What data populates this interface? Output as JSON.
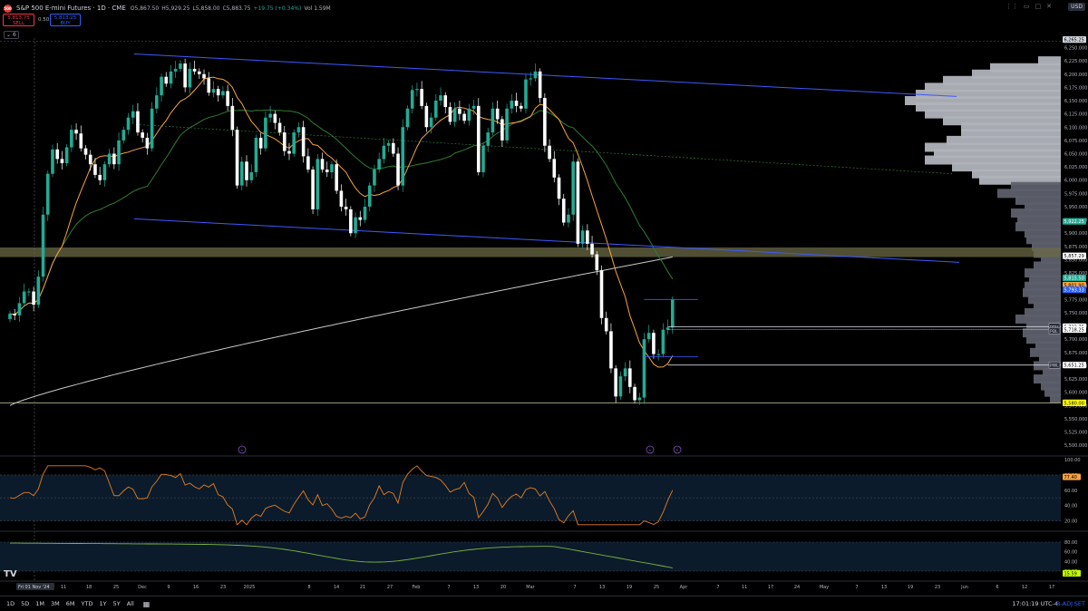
{
  "header": {
    "title": "S&P 500 E-mini Futures · 1D · CME",
    "logo_text": "500",
    "ohlc": {
      "o": "O5,867.50",
      "h": "H5,929.25",
      "l": "L5,858.00",
      "c": "C5,883.75",
      "chg": "+19.75 (+0.34%)",
      "vol": "Vol 1.59M"
    },
    "sell_price": "5,813.75",
    "sell_label": "SELL",
    "buy_price": "5,813.25",
    "buy_label": "BUY",
    "spread": "0.50",
    "collapse_label": "6",
    "currency": "USD",
    "icons": [
      "drag-icon",
      "minimize-icon",
      "maximize-icon",
      "close-icon"
    ]
  },
  "bottom": {
    "timeframes": [
      "1D",
      "5D",
      "1M",
      "3M",
      "6M",
      "YTD",
      "1Y",
      "5Y",
      "All"
    ],
    "clock": "17:01:19 UTC-4",
    "badj": "B-ADJ",
    "set": "SET"
  },
  "colors": {
    "bull": "#22ab94",
    "bear": "#ffffff",
    "ma_fast": "#f7a440",
    "ma_mid": "#2e7d32",
    "ma_slow": "#c8c8c8",
    "channel": "#3d5afe",
    "rsi": "#e67e22",
    "adx": "#7cb342",
    "profile_light": "#b0b3bb",
    "profile_dark": "#5d606b",
    "zone": "#6b6a45"
  },
  "chart_data": [
    {
      "type": "candlestick",
      "title": "S&P 500 E-mini Futures · 1D · CME",
      "yticks": [
        5500,
        5525,
        5550,
        5575,
        5600,
        5625,
        5650,
        5675,
        5700,
        5725,
        5750,
        5775,
        5800,
        5825,
        5850,
        5875,
        5900,
        5925,
        5950,
        5975,
        6000,
        6025,
        6050,
        6075,
        6100,
        6125,
        6150,
        6175,
        6200,
        6225,
        6250
      ],
      "ylim": [
        5490,
        6268
      ],
      "xlabels": [
        "Fri 01 Nov '24",
        "11",
        "18",
        "25",
        "Dec",
        "9",
        "16",
        "23",
        "2025",
        "8",
        "14",
        "21",
        "27",
        "Feb",
        "7",
        "13",
        "20",
        "Mar",
        "7",
        "13",
        "19",
        "25",
        "Apr",
        "7",
        "11",
        "17",
        "24",
        "May",
        "7",
        "13",
        "19",
        "23",
        "Jun",
        "6",
        "12",
        "17"
      ],
      "closes": [
        5748,
        5745,
        5768,
        5790,
        5790,
        5765,
        5818,
        5935,
        6012,
        6058,
        6040,
        6032,
        6062,
        6095,
        6088,
        6060,
        6048,
        6030,
        6010,
        6000,
        6030,
        6050,
        6030,
        6075,
        6095,
        6118,
        6130,
        6090,
        6080,
        6060,
        6135,
        6160,
        6195,
        6182,
        6205,
        6210,
        6220,
        6175,
        6210,
        6205,
        6200,
        6192,
        6165,
        6172,
        6160,
        6168,
        6140,
        6095,
        5990,
        6035,
        6000,
        6015,
        6080,
        6060,
        6118,
        6125,
        6108,
        6090,
        6055,
        6050,
        6090,
        6100,
        6045,
        6020,
        5945,
        6040,
        6020,
        6015,
        6030,
        5980,
        5950,
        5945,
        5900,
        5930,
        5925,
        5950,
        5990,
        6020,
        6040,
        6065,
        6070,
        6050,
        5990,
        6100,
        6135,
        6170,
        6172,
        6140,
        6100,
        6118,
        6150,
        6160,
        6138,
        6110,
        6135,
        6125,
        6112,
        6135,
        6140,
        6015,
        6065,
        6090,
        6135,
        6115,
        6075,
        6135,
        6150,
        6140,
        6135,
        6190,
        6192,
        6205,
        6155,
        6065,
        6040,
        6005,
        5965,
        5920,
        5935,
        6035,
        5880,
        5905,
        5880,
        5860,
        5830,
        5740,
        5715,
        5645,
        5592,
        5630,
        5645,
        5610,
        5585,
        5590,
        5700,
        5712,
        5672,
        5672,
        5718,
        5722,
        5775
      ],
      "current_price": 5813.5,
      "price_labels": [
        "6,265.25",
        "5,922.25",
        "5,857.29",
        "5,815.50",
        "5,801.90",
        "5,793.33",
        "5,723.75",
        "5,718.25",
        "5,651.25",
        "5,580.00"
      ],
      "level_tags": [
        "PDH",
        "PDL",
        "PWL"
      ],
      "channel": {
        "upper": [
          [
            6238,
            6158
          ]
        ],
        "lower": [
          [
            5927,
            5845
          ]
        ]
      },
      "zone": [
        5855,
        5873
      ],
      "support_line": 5580
    },
    {
      "type": "line",
      "yticks": [
        20.0,
        40.0,
        60.0,
        80.0,
        100.0
      ],
      "ylim": [
        10,
        100
      ],
      "last_value_label": "77.40"
    },
    {
      "type": "line",
      "yticks": [
        20.0,
        40.0,
        60.0,
        80.0
      ],
      "ylim": [
        5,
        95
      ],
      "last_value_label": "15.59"
    }
  ]
}
